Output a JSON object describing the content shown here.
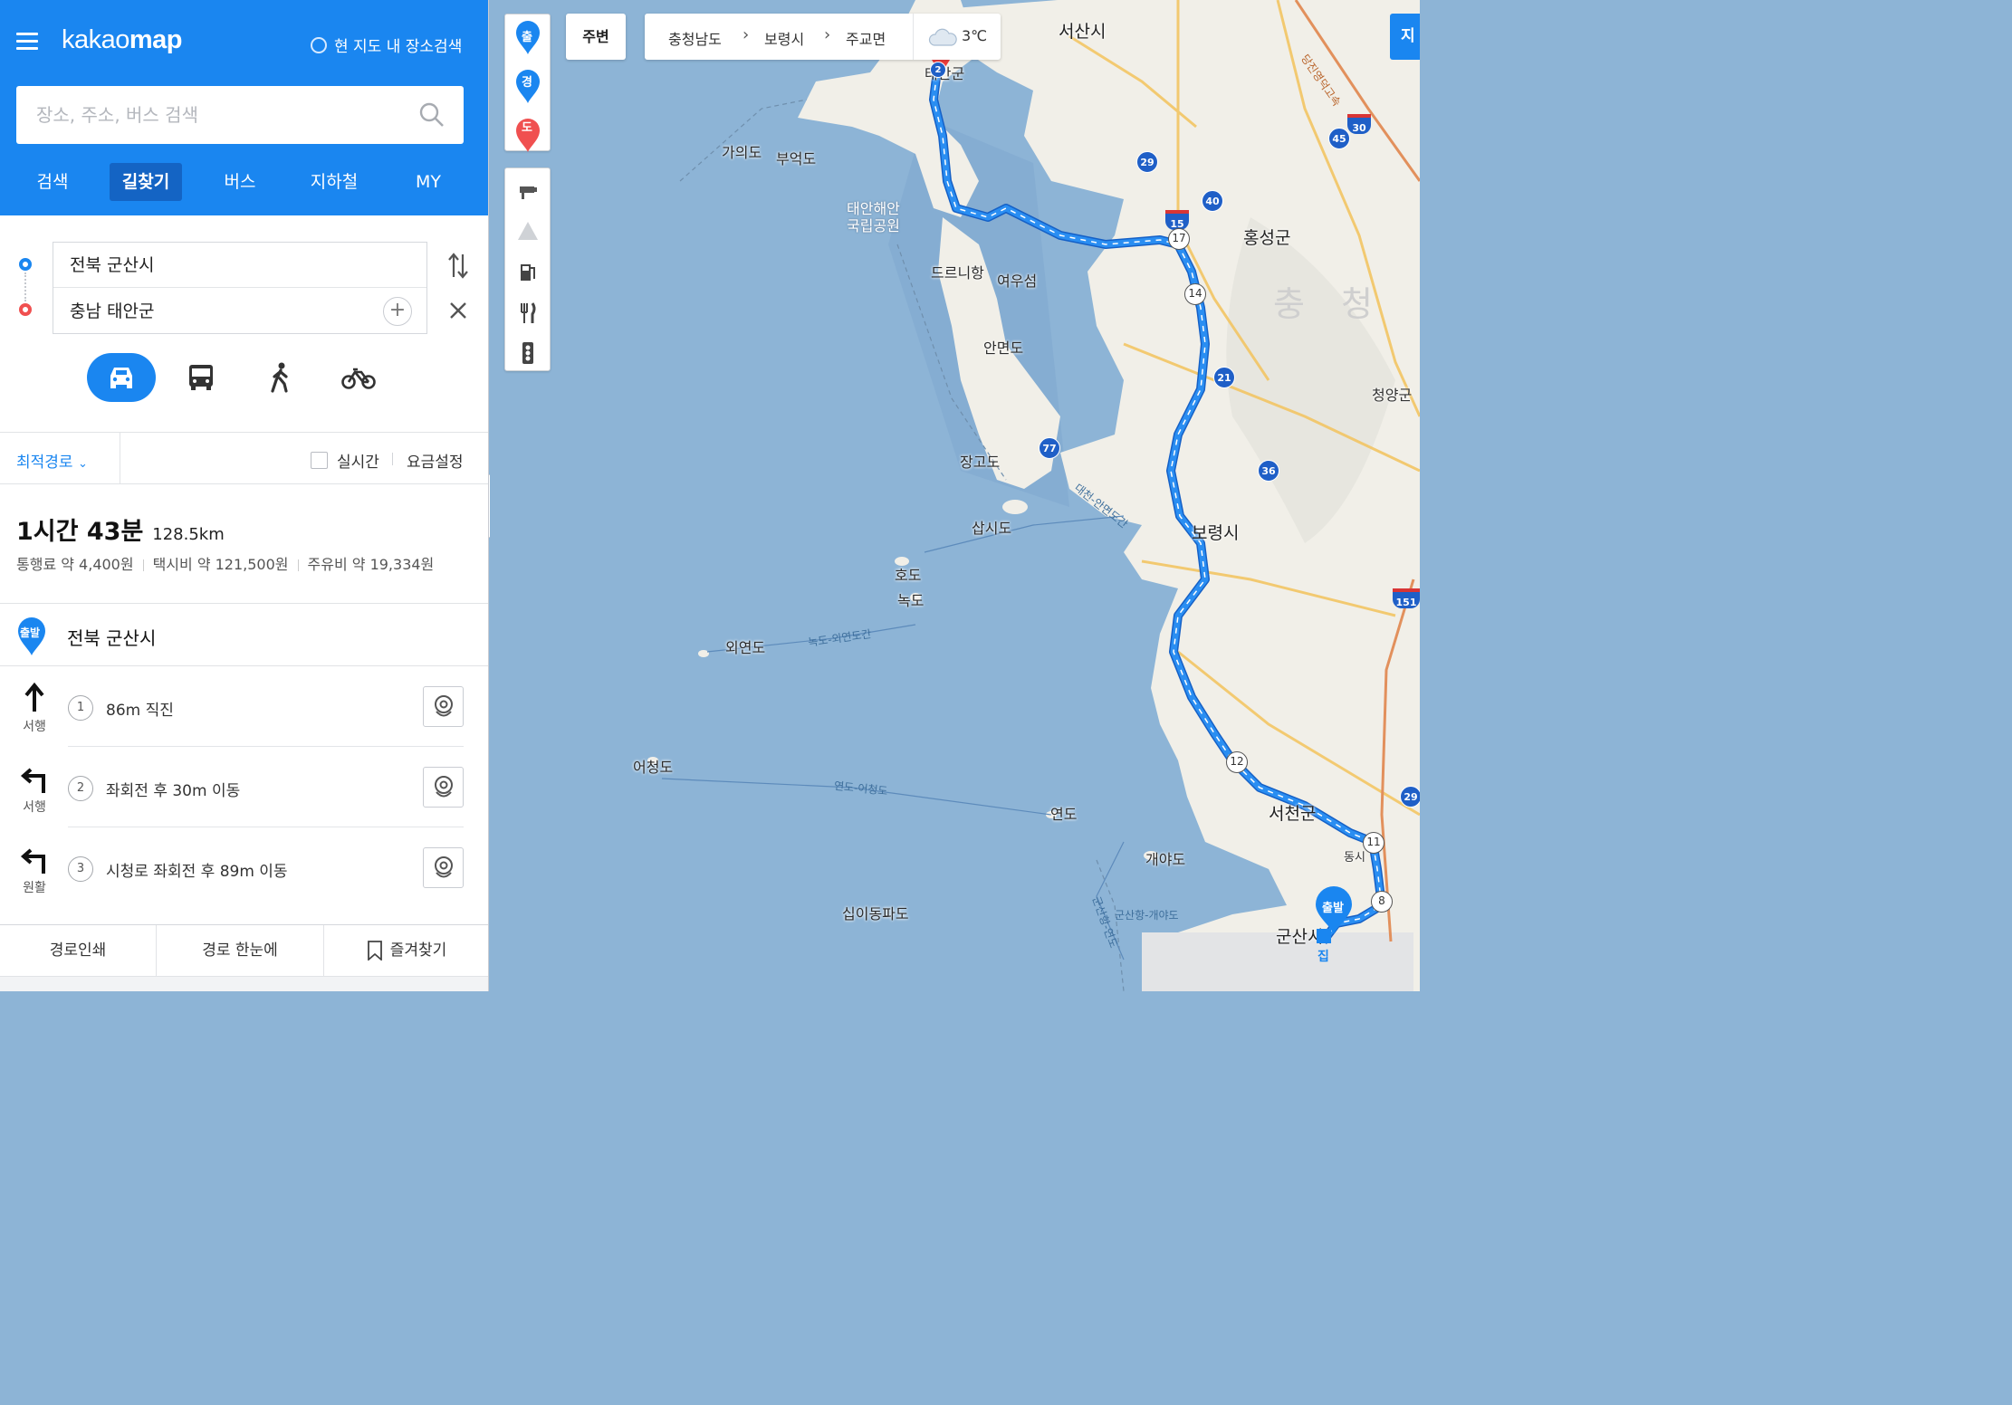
{
  "app": {
    "logo_light": "kakao",
    "logo_bold": "map"
  },
  "header": {
    "area_search_label": "현 지도 내 장소검색",
    "search_placeholder": "장소, 주소, 버스 검색",
    "tabs": [
      "검색",
      "길찾기",
      "버스",
      "지하철",
      "MY"
    ],
    "active_tab": "길찾기"
  },
  "route": {
    "origin": "전북 군산시",
    "destination": "충남 태안군",
    "modes": [
      "car-icon",
      "bus-icon",
      "walk-icon",
      "bike-icon"
    ],
    "active_mode": "car-icon"
  },
  "options": {
    "route_type": "최적경로",
    "realtime_label": "실시간",
    "realtime_checked": false,
    "fare_setting": "요금설정"
  },
  "summary": {
    "time": "1시간 43분",
    "distance": "128.5km",
    "toll": "통행료 약 4,400원",
    "taxi": "택시비 약 121,500원",
    "fuel": "주유비 약 19,334원"
  },
  "start": {
    "badge": "출발",
    "label": "전북 군산시"
  },
  "steps": [
    {
      "num": "1",
      "direction": "서행",
      "icon": "arrow-up-icon",
      "text": "86m 직진"
    },
    {
      "num": "2",
      "direction": "서행",
      "icon": "turn-left-icon",
      "text": "좌회전 후 30m 이동"
    },
    {
      "num": "3",
      "direction": "원활",
      "icon": "turn-left-icon",
      "text": "시청로 좌회전 후 89m 이동"
    }
  ],
  "bottom_bar": {
    "print": "경로인쇄",
    "overview": "경로 한눈에",
    "favorite": "즐겨찾기"
  },
  "map": {
    "nearby_button": "주변",
    "breadcrumb": [
      "충청남도",
      "보령시",
      "주교면"
    ],
    "weather": "3℃",
    "corner_button": "지",
    "pin_buttons": [
      "출",
      "경",
      "도"
    ],
    "labels": {
      "seosan": "서산시",
      "hongseong": "홍성군",
      "boryeong": "보령시",
      "cheongyang": "청양군",
      "seocheon": "서천군",
      "gunsan": "군산시",
      "taean": "태안군",
      "chungcheong": "충 청",
      "gaudo": "가의도",
      "bueokdo": "부억도",
      "park": "태안해안\n국립공원",
      "deurinihang": "드르니항",
      "yeouseom": "여우섬",
      "anmyeondo": "안면도",
      "janggodo": "장고도",
      "sapsido": "삽시도",
      "hodo": "호도",
      "nokdo": "녹도",
      "oeyeondo": "외연도",
      "eocheongdo": "어청도",
      "yeondo": "연도",
      "gaeyado": "개야도",
      "sipidongpado": "십이동파도",
      "dongsi": "동시",
      "home": "집",
      "ferry1": "녹도-외연도간",
      "ferry2": "연도-어청도",
      "ferry3": "군산항-개야도",
      "ferry4": "군산항-연도",
      "bridge": "대천-안면도간",
      "hwy": "당진영덕고속"
    },
    "start_marker": "출발",
    "road_numbers": [
      "29",
      "40",
      "15",
      "17",
      "14",
      "21",
      "36",
      "77",
      "12",
      "11",
      "8",
      "45",
      "30",
      "151",
      "29",
      "2"
    ]
  },
  "colors": {
    "brand_blue": "#1a86f0",
    "route_line": "#2a8ef2",
    "sea": "#8db4d6",
    "land": "#f1efe8"
  }
}
